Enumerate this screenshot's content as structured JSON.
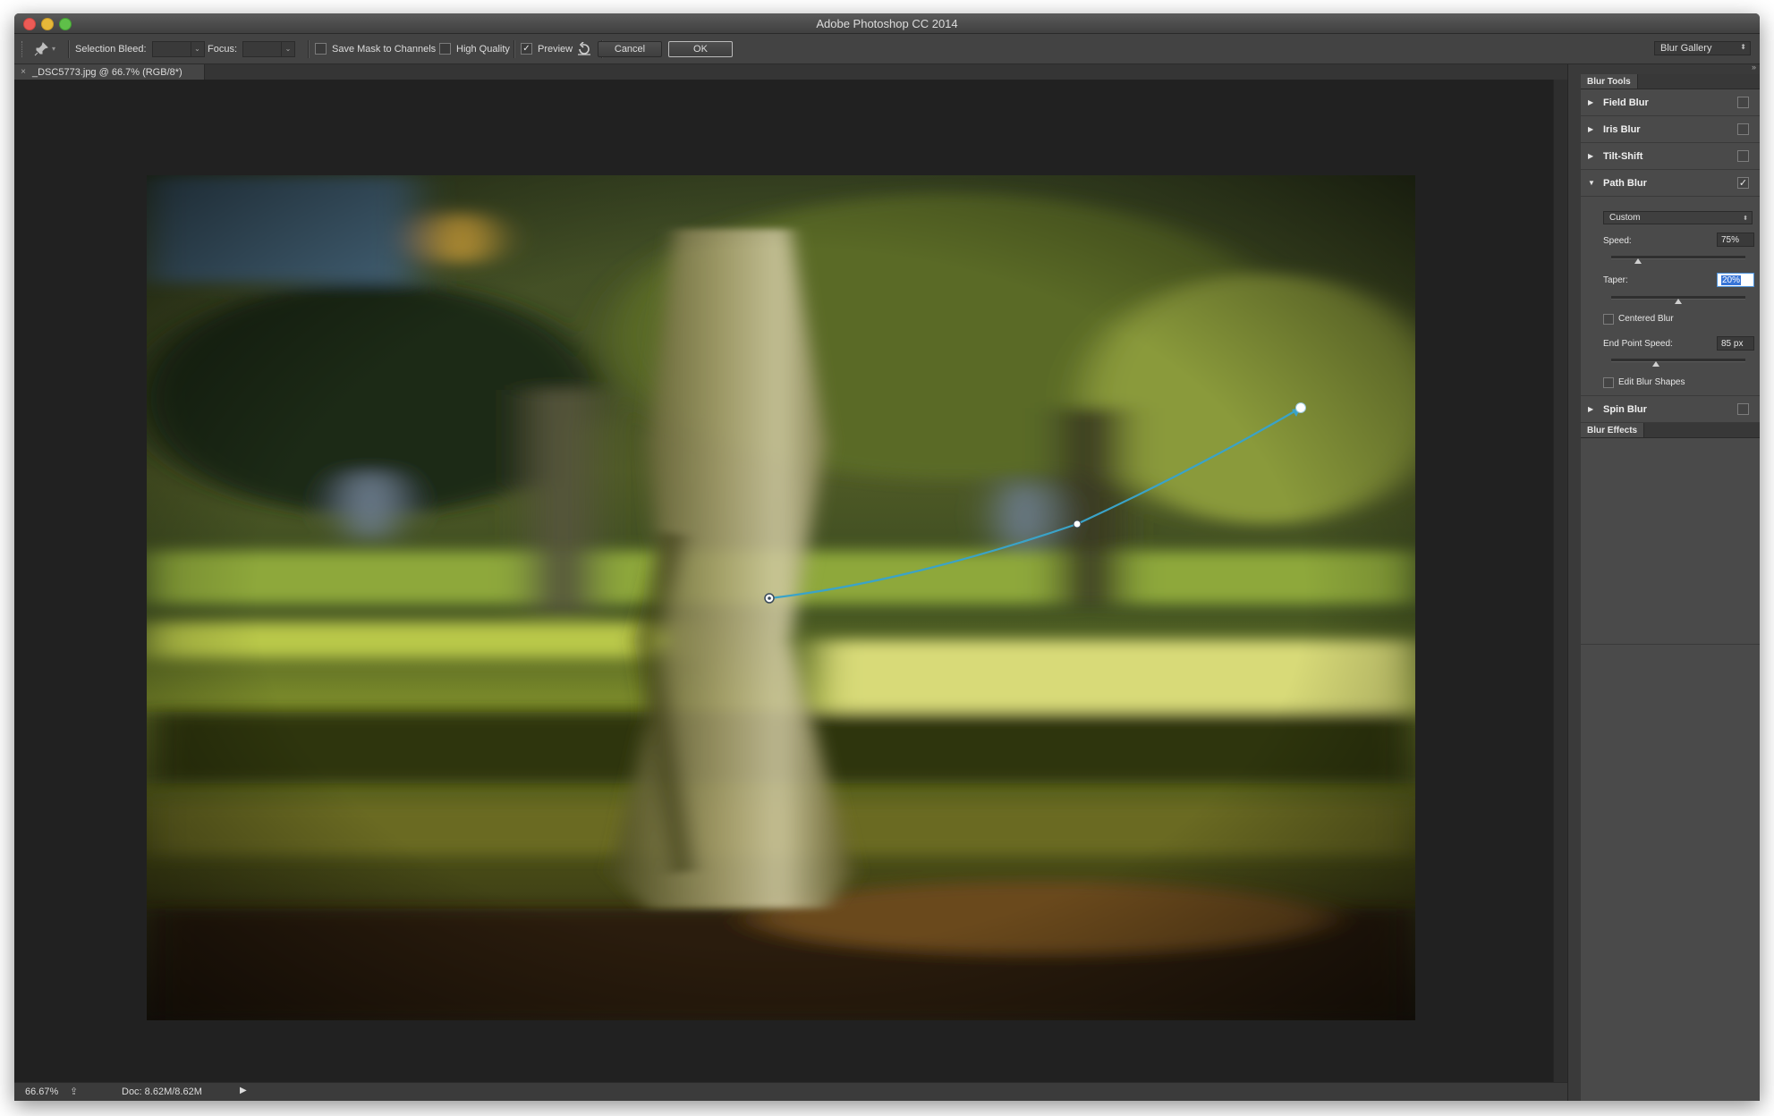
{
  "app": {
    "title": "Adobe Photoshop CC 2014"
  },
  "options_bar": {
    "selection_bleed_label": "Selection Bleed:",
    "focus_label": "Focus:",
    "save_mask_label": "Save Mask to Channels",
    "high_quality_label": "High Quality",
    "preview_label": "Preview",
    "cancel_label": "Cancel",
    "ok_label": "OK",
    "workspace": "Blur Gallery",
    "save_mask_checked": false,
    "high_quality_checked": false,
    "preview_checked": true
  },
  "document": {
    "tab_label": "_DSC5773.jpg @ 66.7% (RGB/8*)",
    "close_glyph": "×"
  },
  "status": {
    "zoom": "66.67%",
    "doc_size": "Doc: 8.62M/8.62M"
  },
  "panel": {
    "blur_tools_title": "Blur Tools",
    "blur_effects_title": "Blur Effects",
    "sections": [
      {
        "label": "Field Blur",
        "expanded": false,
        "checked": false
      },
      {
        "label": "Iris Blur",
        "expanded": false,
        "checked": false
      },
      {
        "label": "Tilt-Shift",
        "expanded": false,
        "checked": false
      },
      {
        "label": "Path Blur",
        "expanded": true,
        "checked": true
      },
      {
        "label": "Spin Blur",
        "expanded": false,
        "checked": false
      }
    ],
    "path_blur": {
      "preset": "Custom",
      "speed_label": "Speed:",
      "speed_value": "75%",
      "speed_level": 0.2,
      "taper_label": "Taper:",
      "taper_value": "20%",
      "taper_level": 0.5,
      "centered_blur_label": "Centered Blur",
      "centered_blur_checked": false,
      "end_point_speed_label": "End Point Speed:",
      "end_point_speed_value": "85 px",
      "end_point_speed_level": 0.33,
      "edit_blur_shapes_label": "Edit Blur Shapes",
      "edit_blur_shapes_checked": false
    }
  },
  "colors": {
    "path_curve": "#3aa3c8",
    "canvas_bg": "#212121",
    "panel_bg": "#4a4a4a"
  },
  "icons": {
    "pin": "pin-icon",
    "reset": "reset-icon",
    "status_menu": "play-triangle-icon"
  }
}
